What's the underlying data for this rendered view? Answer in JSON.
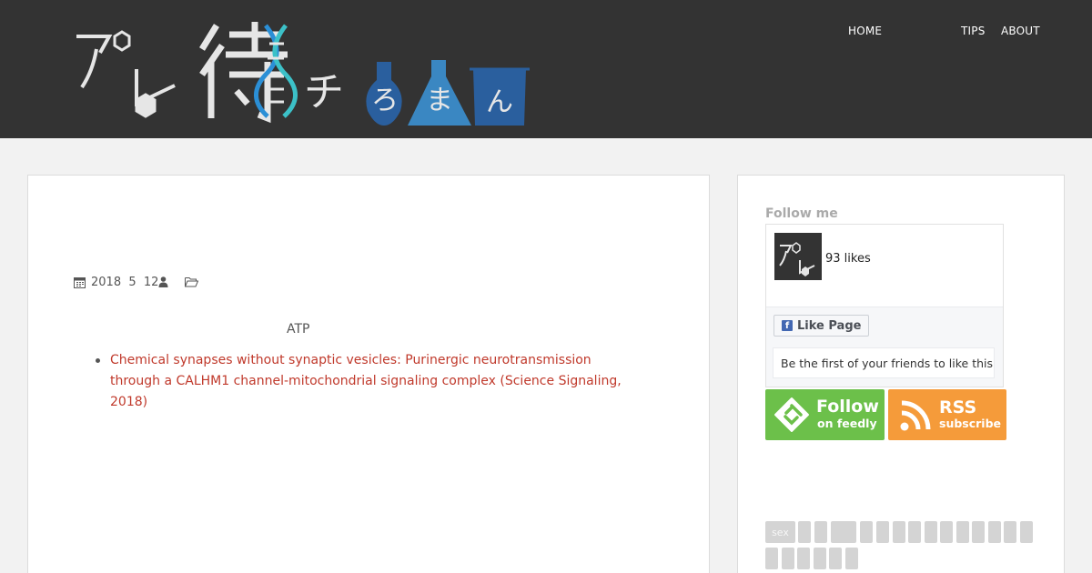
{
  "header": {
    "logo_text": "アレ待",
    "logo_tail": "チ",
    "logo_flask_chars": [
      "ろ",
      "ま",
      "ん"
    ],
    "colors": {
      "background": "#333333",
      "flask_dark": "#2a5f9e",
      "flask_light": "#3a87c2",
      "dna_blue": "#2b8fd6",
      "dna_teal": "#3cc1c8"
    }
  },
  "nav": {
    "items": [
      {
        "label": "HOME"
      },
      {
        "label": "TIPS"
      },
      {
        "label": "ABOUT"
      }
    ]
  },
  "post": {
    "meta": {
      "calendar_icon": "calendar-icon",
      "date": "2018  5  12",
      "author_icon": "user-icon",
      "folder_icon": "folder-open-icon"
    },
    "tag_line": "ATP",
    "links": [
      "Chemical synapses without synaptic vesicles: Purinergic neurotransmission through a CALHM1 channel-mitochondrial signaling complex (Science Signaling, 2018)"
    ],
    "link_color": "#c0392b"
  },
  "sidebar": {
    "follow_title": "Follow me",
    "fb": {
      "likes": "93 likes",
      "like_button": "Like Page",
      "friends_text": "Be the first of your friends to like this"
    },
    "feedly": {
      "main": "Follow",
      "sub": "on feedly",
      "color": "#6cc04a"
    },
    "rss": {
      "main": "RSS",
      "sub": "subscribe",
      "color": "#f59b3a"
    },
    "tags": [
      "sex"
    ]
  }
}
